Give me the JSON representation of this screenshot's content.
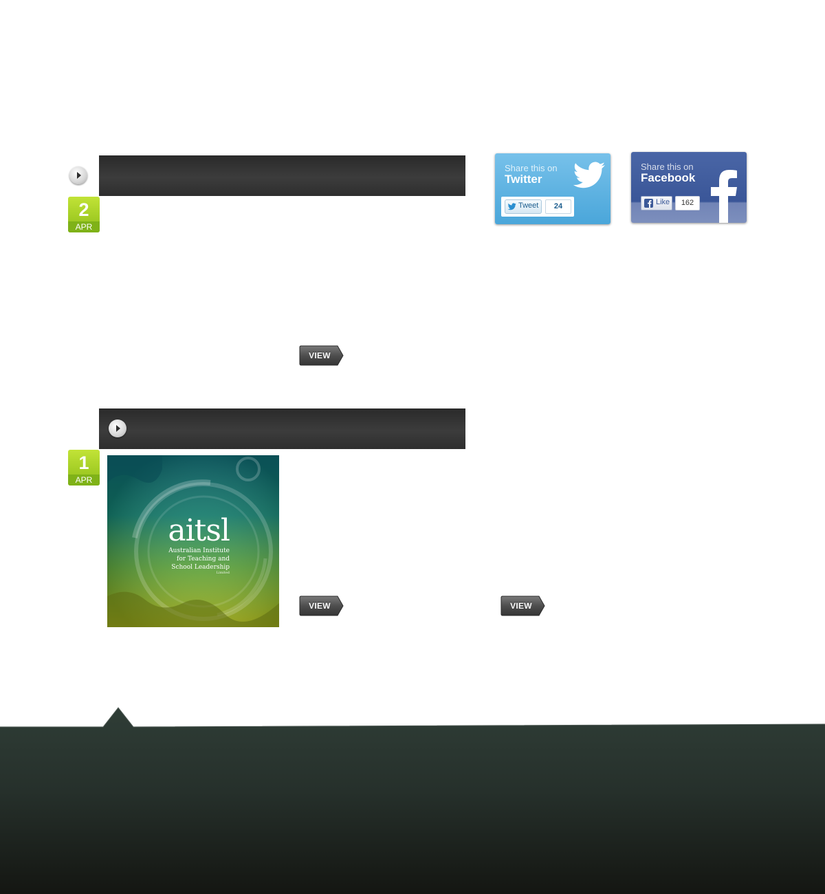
{
  "posts": [
    {
      "date": {
        "day": "2",
        "month": "APR"
      },
      "view_label": "VIEW"
    },
    {
      "date": {
        "day": "1",
        "month": "APR"
      },
      "view_label": "VIEW",
      "second_view_label": "VIEW",
      "image": {
        "wordmark": "aitsl",
        "subtitle_lines": [
          "Australian Institute",
          "for Teaching and",
          "School Leadership"
        ],
        "suffix": "Limited"
      }
    }
  ],
  "share": {
    "twitter": {
      "prefix": "Share this on",
      "network": "Twitter",
      "button_label": "Tweet",
      "count": "24"
    },
    "facebook": {
      "prefix": "Share this on",
      "network": "Facebook",
      "button_label": "Like",
      "count": "162"
    }
  },
  "colors": {
    "date_badge": "#9ccb1f",
    "header_bar": "#333333",
    "twitter": "#55ace0",
    "facebook": "#3b5998",
    "footer": "#243129"
  }
}
